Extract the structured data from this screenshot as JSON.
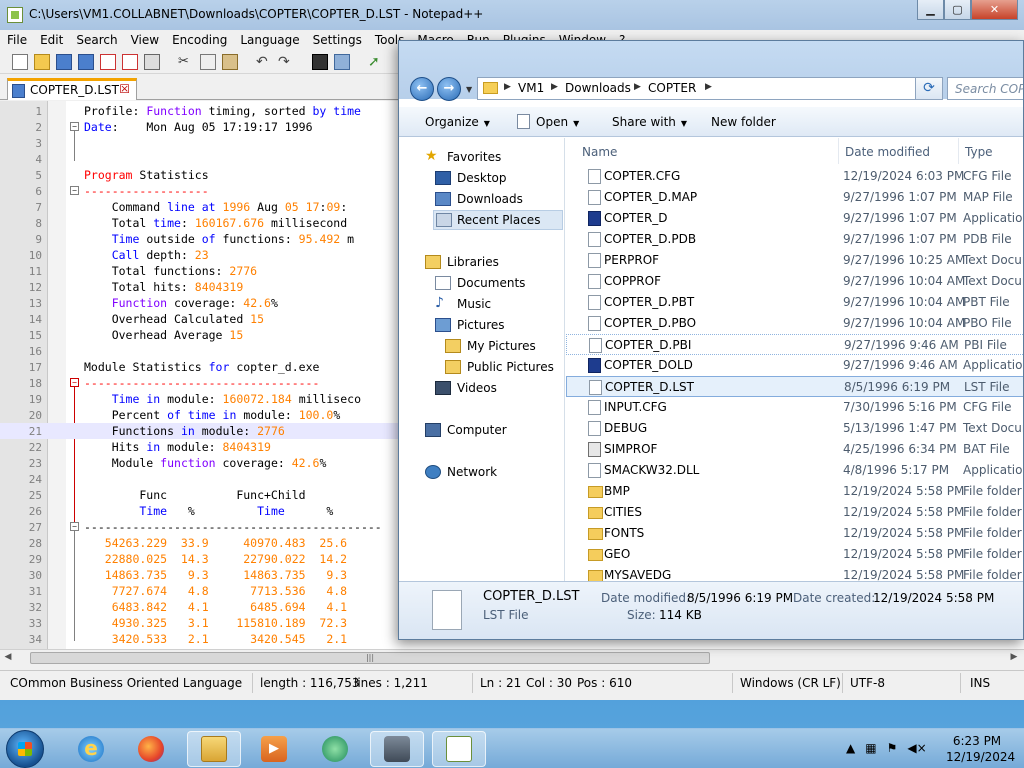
{
  "npp": {
    "title": "C:\\Users\\VM1.COLLABNET\\Downloads\\COPTER\\COPTER_D.LST - Notepad++",
    "menu": [
      "File",
      "Edit",
      "Search",
      "View",
      "Encoding",
      "Language",
      "Settings",
      "Tools",
      "Macro",
      "Run",
      "Plugins",
      "Window",
      "?"
    ],
    "tab": "COPTER_D.LST",
    "tab_close": "☒",
    "lines": [
      {
        "n": "1",
        "text": "Profile: Function timing, sorted by time"
      },
      {
        "n": "2",
        "text": "Date:    Mon Aug 05 17:19:17 1996"
      },
      {
        "n": "3",
        "text": ""
      },
      {
        "n": "4",
        "text": ""
      },
      {
        "n": "5",
        "text": "Program Statistics"
      },
      {
        "n": "6",
        "text": "------------------"
      },
      {
        "n": "7",
        "text": "    Command line at 1996 Aug 05 17:09:"
      },
      {
        "n": "8",
        "text": "    Total time: 160167.676 millisecond"
      },
      {
        "n": "9",
        "text": "    Time outside of functions: 95.492 m"
      },
      {
        "n": "10",
        "text": "    Call depth: 23"
      },
      {
        "n": "11",
        "text": "    Total functions: 2776"
      },
      {
        "n": "12",
        "text": "    Total hits: 8404319"
      },
      {
        "n": "13",
        "text": "    Function coverage: 42.6%"
      },
      {
        "n": "14",
        "text": "    Overhead Calculated 15"
      },
      {
        "n": "15",
        "text": "    Overhead Average 15"
      },
      {
        "n": "16",
        "text": ""
      },
      {
        "n": "17",
        "text": "Module Statistics for copter_d.exe"
      },
      {
        "n": "18",
        "text": "----------------------------------"
      },
      {
        "n": "19",
        "text": "    Time in module: 160072.184 milliseco"
      },
      {
        "n": "20",
        "text": "    Percent of time in module: 100.0%"
      },
      {
        "n": "21",
        "text": "    Functions in module: 2776"
      },
      {
        "n": "22",
        "text": "    Hits in module: 8404319"
      },
      {
        "n": "23",
        "text": "    Module function coverage: 42.6%"
      },
      {
        "n": "24",
        "text": ""
      },
      {
        "n": "25",
        "text": "        Func          Func+Child"
      },
      {
        "n": "26",
        "text": "        Time   %         Time      %"
      },
      {
        "n": "27",
        "text": "-------------------------------------------"
      },
      {
        "n": "28",
        "text": "   54263.229  33.9     40970.483  25.6"
      },
      {
        "n": "29",
        "text": "   22880.025  14.3     22790.022  14.2"
      },
      {
        "n": "30",
        "text": "   14863.735   9.3     14863.735   9.3"
      },
      {
        "n": "31",
        "text": "    7727.674   4.8      7713.536   4.8"
      },
      {
        "n": "32",
        "text": "    6483.842   4.1      6485.694   4.1"
      },
      {
        "n": "33",
        "text": "    4930.325   3.1    115810.189  72.3"
      },
      {
        "n": "34",
        "text": "    3420.533   2.1      3420.545   2.1"
      }
    ],
    "hscroll_grip": "|||",
    "status": {
      "language": "COmmon Business Oriented Language",
      "length": "length : 116,753",
      "lines": "lines : 1,211",
      "ln": "Ln : 21",
      "col": "Col : 30",
      "pos": "Pos : 610",
      "eol": "Windows (CR LF)",
      "encoding": "UTF-8",
      "ins": "INS"
    }
  },
  "explorer": {
    "breadcrumbs": [
      "VM1",
      "Downloads",
      "COPTER"
    ],
    "search_placeholder": "Search COPTER",
    "commands": [
      "Organize",
      "Open",
      "Share with",
      "New folder"
    ],
    "nav": {
      "favorites_header": "Favorites",
      "favorites": [
        "Desktop",
        "Downloads",
        "Recent Places"
      ],
      "libraries_header": "Libraries",
      "libraries": [
        "Documents",
        "Music",
        "Pictures"
      ],
      "pictures_children": [
        "My Pictures",
        "Public Pictures"
      ],
      "videos": "Videos",
      "computer": "Computer",
      "network": "Network"
    },
    "columns": [
      "Name",
      "Date modified",
      "Type"
    ],
    "files": [
      {
        "name": "COPTER.CFG",
        "date": "12/19/2024 6:03 PM",
        "type": "CFG File",
        "icon": "file-icon"
      },
      {
        "name": "COPTER_D.MAP",
        "date": "9/27/1996 1:07 PM",
        "type": "MAP File",
        "icon": "file-icon"
      },
      {
        "name": "COPTER_D",
        "date": "9/27/1996 1:07 PM",
        "type": "Application",
        "icon": "app-icon"
      },
      {
        "name": "COPTER_D.PDB",
        "date": "9/27/1996 1:07 PM",
        "type": "PDB File",
        "icon": "file-icon"
      },
      {
        "name": "PERPROF",
        "date": "9/27/1996 10:25 AM",
        "type": "Text Document",
        "icon": "file-icon"
      },
      {
        "name": "COPPROF",
        "date": "9/27/1996 10:04 AM",
        "type": "Text Document",
        "icon": "file-icon"
      },
      {
        "name": "COPTER_D.PBT",
        "date": "9/27/1996 10:04 AM",
        "type": "PBT File",
        "icon": "file-icon"
      },
      {
        "name": "COPTER_D.PBO",
        "date": "9/27/1996 10:04 AM",
        "type": "PBO File",
        "icon": "file-icon"
      },
      {
        "name": "COPTER_D.PBI",
        "date": "9/27/1996 9:46 AM",
        "type": "PBI File",
        "icon": "file-icon"
      },
      {
        "name": "COPTER_DOLD",
        "date": "9/27/1996 9:46 AM",
        "type": "Application",
        "icon": "app-icon"
      },
      {
        "name": "COPTER_D.LST",
        "date": "8/5/1996 6:19 PM",
        "type": "LST File",
        "icon": "file-icon"
      },
      {
        "name": "INPUT.CFG",
        "date": "7/30/1996 5:16 PM",
        "type": "CFG File",
        "icon": "file-icon"
      },
      {
        "name": "DEBUG",
        "date": "5/13/1996 1:47 PM",
        "type": "Text Document",
        "icon": "file-icon"
      },
      {
        "name": "SIMPROF",
        "date": "4/25/1996 6:34 PM",
        "type": "BAT File",
        "icon": "bat-icon"
      },
      {
        "name": "SMACKW32.DLL",
        "date": "4/8/1996 5:17 PM",
        "type": "Application",
        "icon": "file-icon"
      },
      {
        "name": "BMP",
        "date": "12/19/2024 5:58 PM",
        "type": "File folder",
        "icon": "folder-icon"
      },
      {
        "name": "CITIES",
        "date": "12/19/2024 5:58 PM",
        "type": "File folder",
        "icon": "folder-icon"
      },
      {
        "name": "FONTS",
        "date": "12/19/2024 5:58 PM",
        "type": "File folder",
        "icon": "folder-icon"
      },
      {
        "name": "GEO",
        "date": "12/19/2024 5:58 PM",
        "type": "File folder",
        "icon": "folder-icon"
      },
      {
        "name": "MYSAVEDG",
        "date": "12/19/2024 5:58 PM",
        "type": "File folder",
        "icon": "folder-icon"
      }
    ],
    "details": {
      "name": "COPTER_D.LST",
      "type": "LST File",
      "modified_label": "Date modified:",
      "modified": "8/5/1996 6:19 PM",
      "created_label": "Date created:",
      "created": "12/19/2024 5:58 PM",
      "size_label": "Size:",
      "size": "114 KB"
    }
  },
  "taskbar": {
    "time": "6:23 PM",
    "date": "12/19/2024"
  }
}
